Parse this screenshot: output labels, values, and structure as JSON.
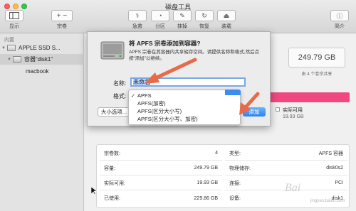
{
  "window": {
    "title": "磁盘工具"
  },
  "toolbar": {
    "items": [
      {
        "label": "显示",
        "icon": "sidebar-icon"
      },
      {
        "label": "宗卷",
        "icon": "plus-minus-icon"
      },
      {
        "label": "急救",
        "icon": "stethoscope-icon"
      },
      {
        "label": "分区",
        "icon": "pie-icon"
      },
      {
        "label": "抹掉",
        "icon": "eraser-icon"
      },
      {
        "label": "恢复",
        "icon": "restore-icon"
      },
      {
        "label": "装载",
        "icon": "mount-icon"
      },
      {
        "label": "简介",
        "icon": "info-icon"
      }
    ]
  },
  "sidebar": {
    "section": "内置",
    "items": [
      {
        "label": "APPLE SSD S..."
      },
      {
        "label": "容器“disk1”"
      },
      {
        "label": "macbook"
      }
    ]
  },
  "main": {
    "capacity": "249.79 GB",
    "shared_note": "由 4 个卷宗共享",
    "available_label": "实际可用",
    "available_value": "19.93 GB",
    "info": [
      {
        "label": "宗卷数:",
        "value": "4"
      },
      {
        "label": "类型:",
        "value": "APFS 容器"
      },
      {
        "label": "容量:",
        "value": "249.79 GB"
      },
      {
        "label": "物理储存:",
        "value": "disk0s2"
      },
      {
        "label": "实际可用:",
        "value": "19.93 GB"
      },
      {
        "label": "连接:",
        "value": "PCI"
      },
      {
        "label": "已使用:",
        "value": "229.86 GB"
      },
      {
        "label": "设备:",
        "value": "disk1"
      }
    ]
  },
  "dialog": {
    "title": "将 APFS 宗卷添加到容器?",
    "description": "APFS 宗卷在其容器内共享储存空间。请提供名称和格式,然后点按“添加”以继续。",
    "name_label": "名称:",
    "name_value": "未命名",
    "format_label": "格式:",
    "size_button": "大小选项...",
    "add_button": "添加"
  },
  "format_menu": {
    "selected_mark": "✓",
    "options": [
      "APFS",
      "APFS(加密)",
      "APFS(区分大小写)",
      "APFS(区分大小写、加密)"
    ]
  },
  "watermark": {
    "text": "Bai",
    "sub": "jingyan.baidu.com"
  },
  "colors": {
    "accent": "#3d8df0",
    "usage": "#f04880",
    "arrow": "#e86a4a"
  }
}
